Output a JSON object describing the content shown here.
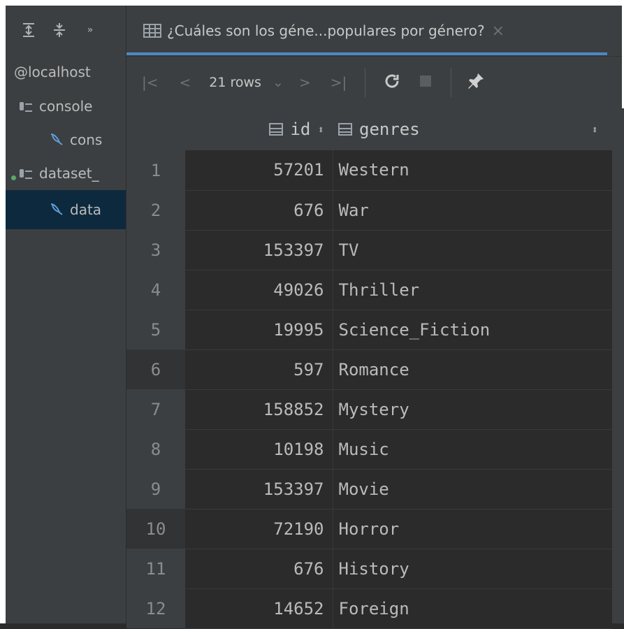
{
  "sidebar": {
    "tree": [
      {
        "label": "@localhost",
        "indent": 0
      },
      {
        "label": "console",
        "indent": 1
      },
      {
        "label": "cons",
        "indent": 2
      },
      {
        "label": "dataset_",
        "indent": 1
      },
      {
        "label": "data",
        "indent": 2
      }
    ]
  },
  "tab": {
    "title": "¿Cuáles son los géne...populares por género?",
    "close_glyph": "×"
  },
  "toolbar": {
    "rows_label": "21 rows"
  },
  "table": {
    "columns": [
      "id",
      "genres"
    ],
    "rows": [
      {
        "n": "1",
        "id": "57201",
        "genres": "Western"
      },
      {
        "n": "2",
        "id": "676",
        "genres": "War"
      },
      {
        "n": "3",
        "id": "153397",
        "genres": "TV"
      },
      {
        "n": "4",
        "id": "49026",
        "genres": "Thriller"
      },
      {
        "n": "5",
        "id": "19995",
        "genres": "Science_Fiction"
      },
      {
        "n": "6",
        "id": "597",
        "genres": "Romance"
      },
      {
        "n": "7",
        "id": "158852",
        "genres": "Mystery"
      },
      {
        "n": "8",
        "id": "10198",
        "genres": "Music"
      },
      {
        "n": "9",
        "id": "153397",
        "genres": "Movie"
      },
      {
        "n": "10",
        "id": "72190",
        "genres": "Horror"
      },
      {
        "n": "11",
        "id": "676",
        "genres": "History"
      },
      {
        "n": "12",
        "id": "14652",
        "genres": "Foreign"
      }
    ]
  },
  "colors": {
    "background": "#2b2b2b",
    "panel": "#3c3f41",
    "accent": "#4a88c7",
    "selection": "#0d293e"
  }
}
